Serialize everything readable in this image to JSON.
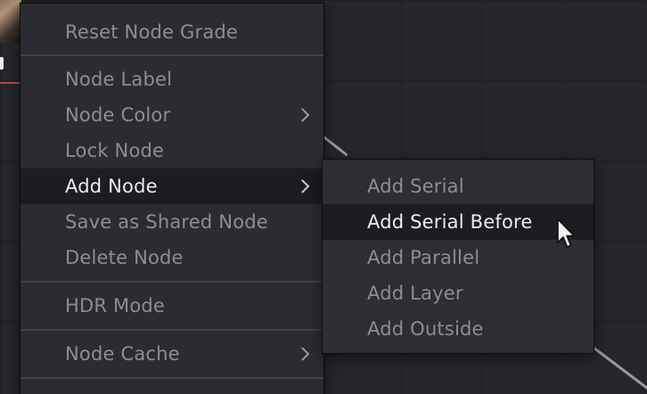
{
  "main_menu": {
    "reset_node_grade": "Reset Node Grade",
    "node_label": "Node Label",
    "node_color": "Node Color",
    "lock_node": "Lock Node",
    "add_node": "Add Node",
    "save_as_shared_node": "Save as Shared Node",
    "delete_node": "Delete Node",
    "hdr_mode": "HDR Mode",
    "node_cache": "Node Cache"
  },
  "add_node_submenu": {
    "items": [
      "Add Serial",
      "Add Serial Before",
      "Add Parallel",
      "Add Layer",
      "Add Outside"
    ],
    "highlighted": "Add Serial Before"
  },
  "colors": {
    "menu_bg": "#2b2b31",
    "highlight_bg": "#1c1c21",
    "text_dim": "#8d8d93",
    "text_bright": "#ececee",
    "canvas_bg": "#27272b",
    "connector": "#9b9b9b"
  },
  "icons": {
    "chevron": "chevron-right-icon",
    "cursor": "mouse-pointer-icon"
  }
}
